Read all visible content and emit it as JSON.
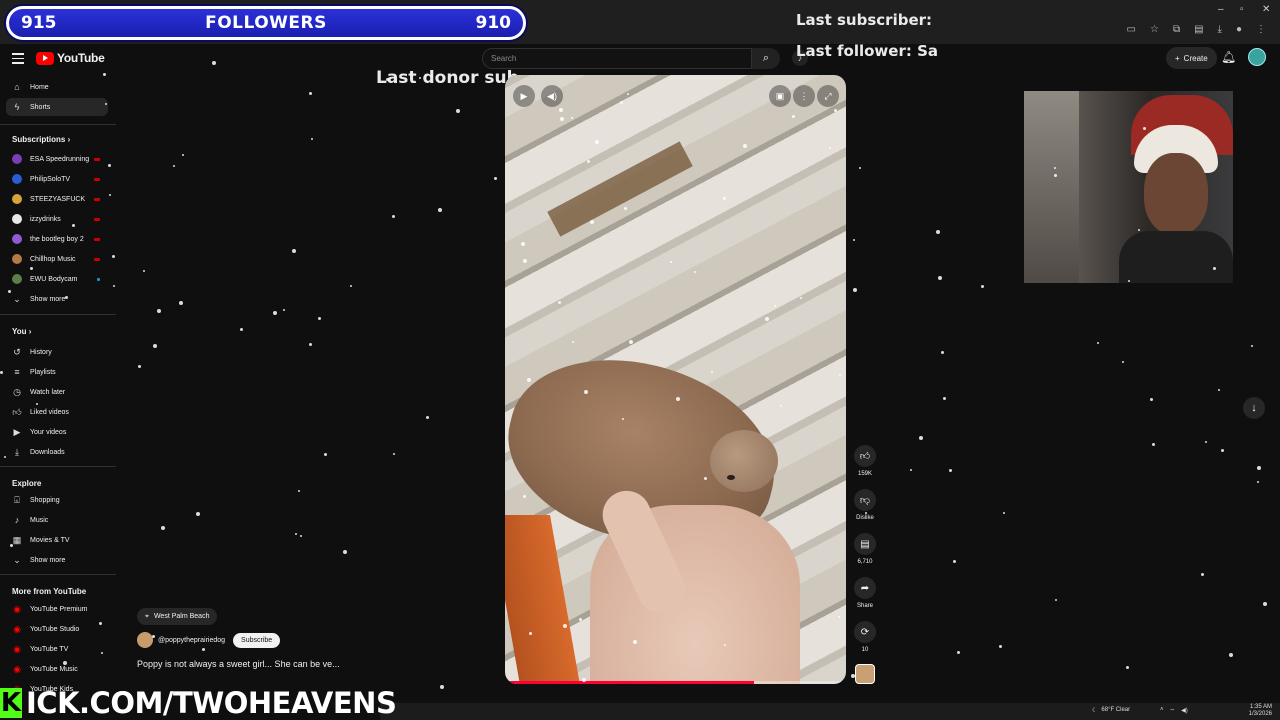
{
  "follower_banner": {
    "left_count": "915",
    "title": "FOLLOWERS",
    "right_count": "910"
  },
  "overlay": {
    "last_donor": "Last donor sub",
    "last_subscriber": "Last subscriber:",
    "last_follower": "Last follower: Sa"
  },
  "header": {
    "logo_text": "YouTube",
    "search_placeholder": "Search",
    "create_label": "Create"
  },
  "sidebar": {
    "main": [
      {
        "label": "Home",
        "icon": "home-icon"
      },
      {
        "label": "Shorts",
        "icon": "shorts-icon",
        "active": true
      }
    ],
    "subscriptions_title": "Subscriptions",
    "subscriptions": [
      {
        "label": "ESA Speedrunning",
        "color": "#7b3fb5"
      },
      {
        "label": "PhilipSoloTV",
        "color": "#2c5bd6"
      },
      {
        "label": "STEEZYASFUCK",
        "color": "#d6a43a"
      },
      {
        "label": "izzydrinks",
        "color": "#e8e8e8"
      },
      {
        "label": "the bootleg boy 2",
        "color": "#8e5ad6"
      },
      {
        "label": "Chillhop Music",
        "color": "#b47a48"
      },
      {
        "label": "EWU Bodycam",
        "color": "#5b7d4a"
      }
    ],
    "show_more": "Show more",
    "you_title": "You",
    "you": [
      {
        "label": "History",
        "icon": "history-icon"
      },
      {
        "label": "Playlists",
        "icon": "playlists-icon"
      },
      {
        "label": "Watch later",
        "icon": "watch-later-icon"
      },
      {
        "label": "Liked videos",
        "icon": "thumbs-up-icon"
      },
      {
        "label": "Your videos",
        "icon": "your-videos-icon"
      },
      {
        "label": "Downloads",
        "icon": "download-icon"
      }
    ],
    "explore_title": "Explore",
    "explore": [
      {
        "label": "Shopping",
        "icon": "shopping-icon"
      },
      {
        "label": "Music",
        "icon": "music-icon"
      },
      {
        "label": "Movies & TV",
        "icon": "movies-icon"
      }
    ],
    "show_more_2": "Show more",
    "more_title": "More from YouTube",
    "more": [
      {
        "label": "YouTube Premium"
      },
      {
        "label": "YouTube Studio"
      },
      {
        "label": "YouTube TV"
      },
      {
        "label": "YouTube Music"
      },
      {
        "label": "YouTube Kids"
      }
    ]
  },
  "video": {
    "progress": 0.73,
    "location": "West Palm Beach",
    "channel": "@poppytheprairiedog",
    "subscribe_label": "Subscribe",
    "description": "Poppy is not always a sweet girl... She can be ve..."
  },
  "actions": {
    "likes": "159K",
    "dislike_label": "Dislike",
    "comments": "6,710",
    "share_label": "Share",
    "remix": "10"
  },
  "kick": {
    "k": "K",
    "text": "ICK.COM/TWOHEAVENS"
  },
  "taskbar": {
    "weather": "68°F Clear",
    "time": "1:35 AM",
    "date": "1/3/2026"
  },
  "colors": {
    "yt_red": "#ff0000",
    "kick_green": "#53fc18",
    "banner_blue": "#2b31d8"
  }
}
